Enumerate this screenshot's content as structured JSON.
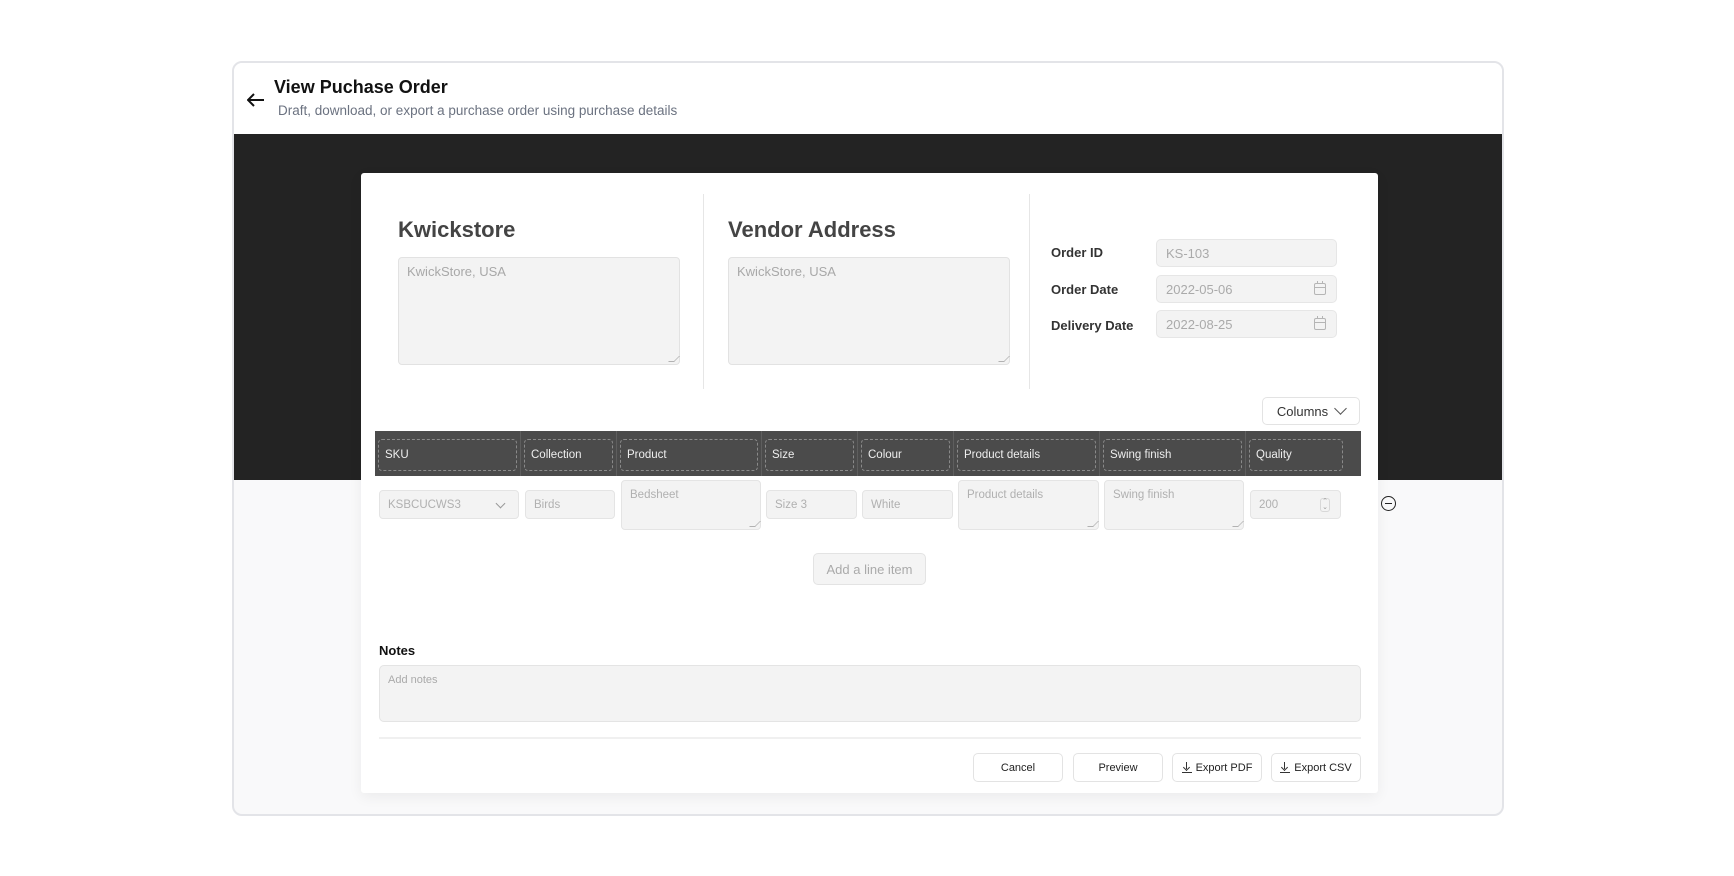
{
  "header": {
    "title": "View Puchase Order",
    "subtitle": "Draft, download, or export a purchase order using purchase details",
    "back_icon": "arrow-left-icon"
  },
  "store": {
    "title": "Kwickstore",
    "address_placeholder": "KwickStore, USA"
  },
  "vendor": {
    "title": "Vendor Address",
    "address_placeholder": "KwickStore, USA"
  },
  "meta": {
    "order_id_label": "Order ID",
    "order_id_value": "KS-103",
    "order_date_label": "Order Date",
    "order_date_value": "2022-05-06",
    "delivery_date_label": "Delivery Date",
    "delivery_date_value": "2022-08-25"
  },
  "columns_button": {
    "label": "Columns",
    "icon": "chevron-down-icon"
  },
  "table": {
    "headers": [
      "SKU",
      "Collection",
      "Product",
      "Size",
      "Colour",
      "Product details",
      "Swing finish",
      "Quality"
    ],
    "rows": [
      {
        "sku": "KSBCUCWS3",
        "collection": "Birds",
        "product": "Bedsheet",
        "size": "Size 3",
        "colour": "White",
        "product_details": "Product details",
        "swing_finish": "Swing finish",
        "quality": "200"
      }
    ]
  },
  "add_line_item": "Add a line item",
  "notes": {
    "label": "Notes",
    "placeholder": "Add notes"
  },
  "footer": {
    "cancel": "Cancel",
    "preview": "Preview",
    "export_pdf": "Export PDF",
    "export_csv": "Export CSV"
  },
  "colors": {
    "dark_band": "#232323",
    "table_header": "#4b4b4b",
    "input_bg": "#f3f3f3",
    "subtitle": "#6b7280"
  }
}
